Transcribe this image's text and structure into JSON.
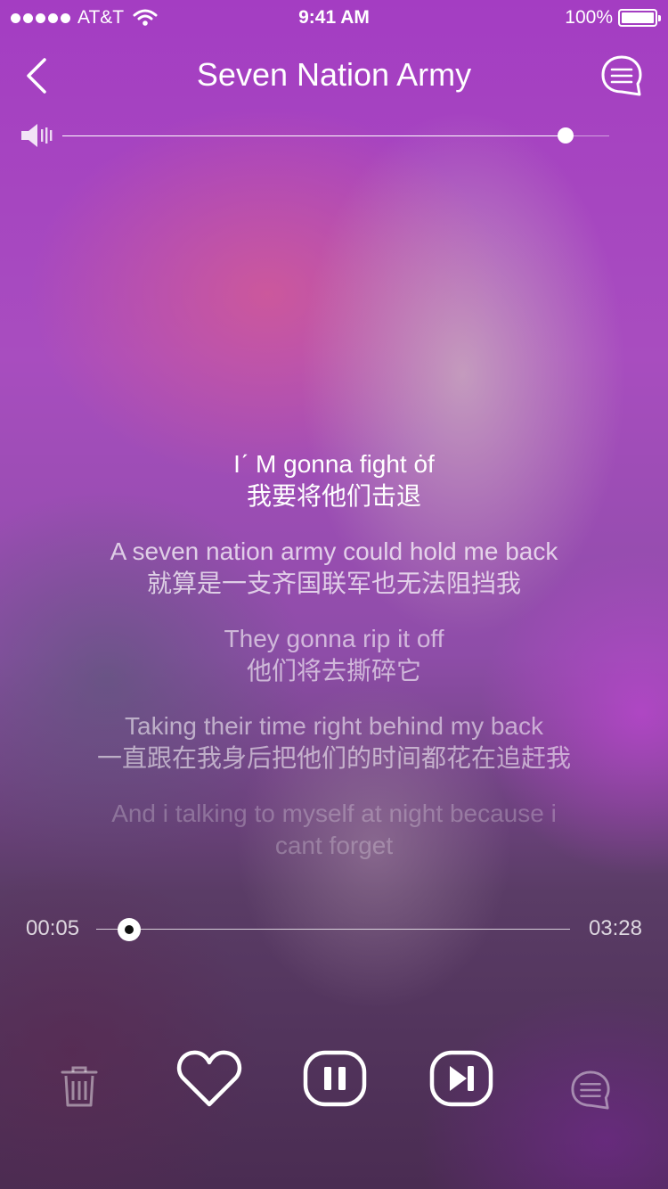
{
  "status_bar": {
    "carrier": "AT&T",
    "time": "9:41 AM",
    "battery": "100%"
  },
  "nav": {
    "title": "Seven Nation Army"
  },
  "volume": {
    "level": 0.92
  },
  "lyrics": [
    {
      "en": "Iˊ M gonna fight ȯf",
      "zh": "我要将他们击退",
      "state": "active"
    },
    {
      "en": "A seven nation army could hold me back",
      "zh": "就算是一支齐国联军也无法阻挡我",
      "state": "n1"
    },
    {
      "en": "They gonna rip it off",
      "zh": "他们将去撕碎它",
      "state": "n2"
    },
    {
      "en": "Taking their time right behind my back",
      "zh": "一直跟在我身后把他们的时间都花在追赶我",
      "state": "n3"
    },
    {
      "en": "And i talking to myself at night because i cant forget",
      "zh": "",
      "state": "n4"
    }
  ],
  "progress": {
    "current": "00:05",
    "total": "03:28",
    "fraction": 0.07
  },
  "icons": {
    "back": "chevron-left-icon",
    "menu": "chat-bubble-list-icon",
    "volume": "speaker-icon",
    "delete": "trash-icon",
    "like": "heart-icon",
    "pause": "pause-icon",
    "next": "next-track-icon",
    "comment": "chat-bubble-list-icon"
  }
}
